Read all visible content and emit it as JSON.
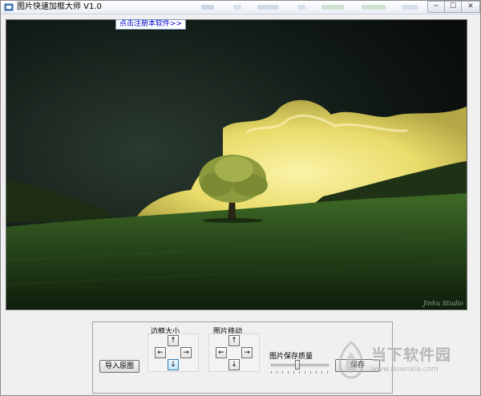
{
  "window": {
    "title": "图片快速加框大师 V1.0",
    "controls": {
      "minimize": "─",
      "maximize": "☐",
      "close": "✕"
    }
  },
  "register_link": "点击注册本软件>>",
  "preview": {
    "image_icon": "landscape-tree-image",
    "credit": "Jinhu Studio"
  },
  "panel": {
    "import_button": "导入原图",
    "border_size_label": "边框大小",
    "move_image_label": "图片移动",
    "quality_label": "图片保存质量",
    "save_button": "保存",
    "arrows": {
      "up": "↑",
      "down": "↓",
      "left": "←",
      "right": "→"
    },
    "quality_value": 0.45
  },
  "watermark": {
    "name": "当下软件园",
    "url": "www.downxia.com"
  },
  "colors": {
    "link": "#0000cc",
    "accent": "#3c7fb1"
  }
}
